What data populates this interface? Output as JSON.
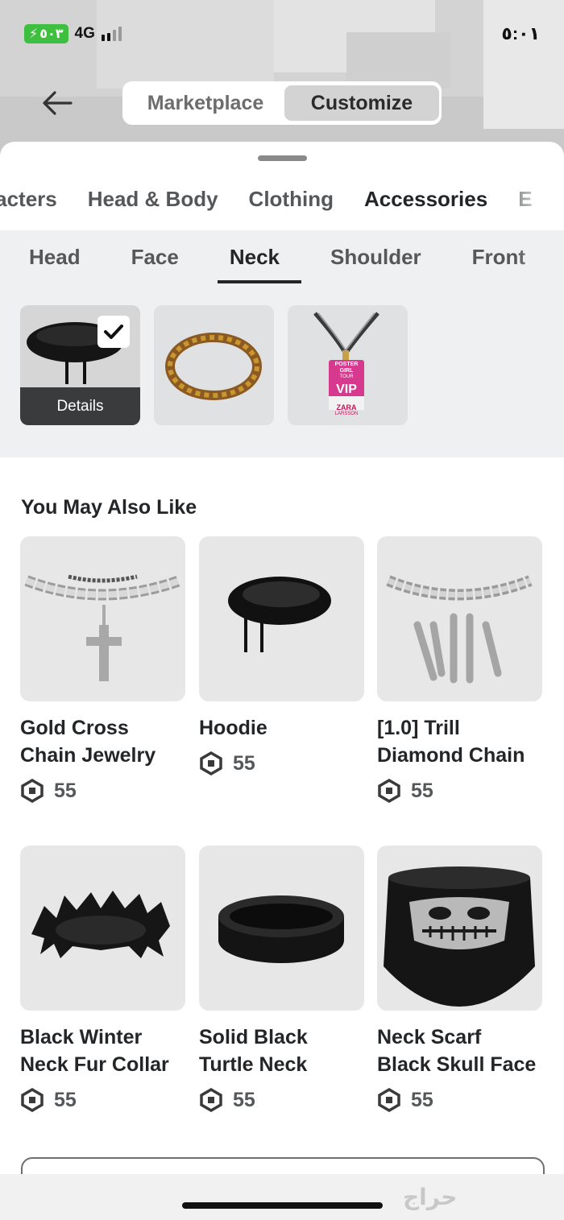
{
  "status_bar": {
    "battery": "٥٠٣",
    "network": "4G",
    "time": "٥:٠١"
  },
  "header": {
    "back_icon": "arrow-left-icon",
    "segments": [
      "Marketplace",
      "Customize"
    ],
    "active_segment": "Customize"
  },
  "category_tabs": [
    "racters",
    "Head & Body",
    "Clothing",
    "Accessories",
    "E"
  ],
  "active_category": "Accessories",
  "sub_tabs": [
    "Head",
    "Face",
    "Neck",
    "Shoulder",
    "Front"
  ],
  "active_sub_tab": "Neck",
  "equipped": {
    "details_label": "Details",
    "badge": {
      "line1": "POSTER GIRL",
      "line2": "TOUR",
      "vip": "VIP",
      "line3": "ZARA",
      "line4": "LARSSON"
    }
  },
  "recommendations": {
    "title": "You May Also Like",
    "items": [
      {
        "name_line1": "Gold Cross",
        "name_line2": "Chain Jewelry",
        "price": "55"
      },
      {
        "name_line1": "Hoodie",
        "name_line2": "",
        "price": "55"
      },
      {
        "name_line1": "[1.0] Trill",
        "name_line2": "Diamond Chain",
        "price": "55"
      },
      {
        "name_line1": "Black Winter",
        "name_line2": "Neck Fur Collar",
        "price": "55"
      },
      {
        "name_line1": "Solid Black",
        "name_line2": "Turtle Neck",
        "price": "55"
      },
      {
        "name_line1": "Neck Scarf",
        "name_line2": "Black Skull Face",
        "price": "55"
      }
    ]
  },
  "watermark": "حراج",
  "colors": {
    "accent_text": "#232527",
    "muted_text": "#555759",
    "battery_green": "#3fbf3f",
    "panel_gray": "#eff0f1"
  },
  "icons": {
    "robux": "robux-icon",
    "check": "checkmark-icon"
  }
}
